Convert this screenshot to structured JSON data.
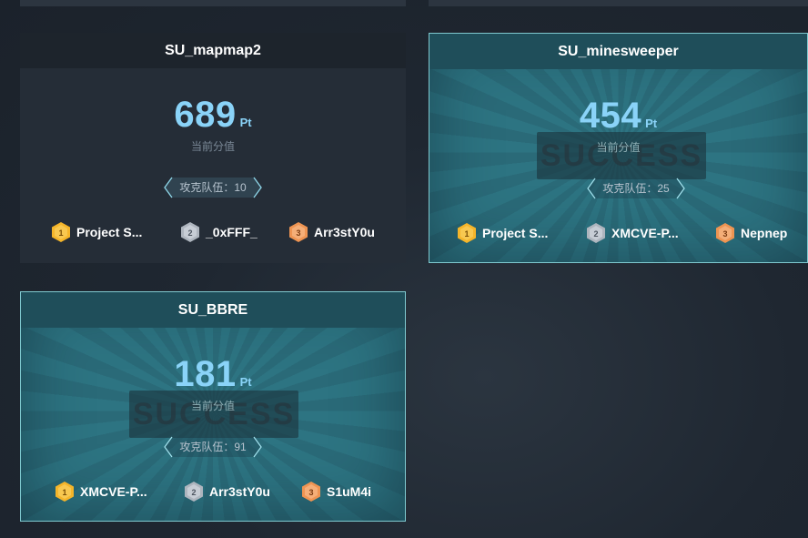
{
  "colors": {
    "gold": "#f5b52a",
    "silver": "#c2c8d0",
    "bronze": "#f0a161",
    "score": "#8ad3f8",
    "solved_border": "#7fc9cf"
  },
  "cards": [
    {
      "title": "SU_mapmap2",
      "score": "689",
      "unit": "Pt",
      "sublabel": "当前分值",
      "teams_label": "攻克队伍：10",
      "solved": false,
      "ranks": [
        {
          "place": "1",
          "team": "Project S...",
          "medal": "gold-medal-icon"
        },
        {
          "place": "2",
          "team": "_0xFFF_",
          "medal": "silver-medal-icon"
        },
        {
          "place": "3",
          "team": "Arr3stY0u",
          "medal": "bronze-medal-icon"
        }
      ]
    },
    {
      "title": "SU_minesweeper",
      "score": "454",
      "unit": "Pt",
      "sublabel": "当前分值",
      "teams_label": "攻克队伍：25",
      "solved": true,
      "stamp": "SUCCESS",
      "ranks": [
        {
          "place": "1",
          "team": "Project S...",
          "medal": "gold-medal-icon"
        },
        {
          "place": "2",
          "team": "XMCVE-P...",
          "medal": "silver-medal-icon"
        },
        {
          "place": "3",
          "team": "Nepnep",
          "medal": "bronze-medal-icon"
        }
      ]
    },
    {
      "title": "SU_BBRE",
      "score": "181",
      "unit": "Pt",
      "sublabel": "当前分值",
      "teams_label": "攻克队伍：91",
      "solved": true,
      "stamp": "SUCCESS",
      "ranks": [
        {
          "place": "1",
          "team": "XMCVE-P...",
          "medal": "gold-medal-icon"
        },
        {
          "place": "2",
          "team": "Arr3stY0u",
          "medal": "silver-medal-icon"
        },
        {
          "place": "3",
          "team": "S1uM4i",
          "medal": "bronze-medal-icon"
        }
      ]
    }
  ]
}
